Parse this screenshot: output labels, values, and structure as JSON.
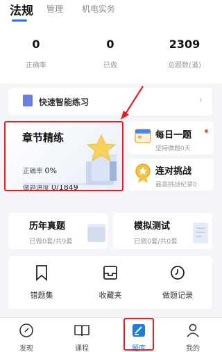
{
  "tabs": [
    {
      "label": "法规",
      "active": true
    },
    {
      "label": "管理",
      "active": false
    },
    {
      "label": "机电实务",
      "active": false
    }
  ],
  "stats": [
    {
      "value": "0",
      "label": "正确率"
    },
    {
      "value": "0",
      "label": "已做"
    },
    {
      "value": "2309",
      "label": "总题数(道)"
    }
  ],
  "quick_practice": {
    "label": "快速智能练习",
    "icon": "book-icon"
  },
  "chapter": {
    "title": "章节精练",
    "accuracy_label": "正确率",
    "accuracy_value": "0%",
    "progress_label": "做题进度",
    "progress_value": "0/1849",
    "progress_fraction": 0.0
  },
  "daily": {
    "title": "每日一题",
    "sub": "坚持做题0天",
    "icon": "calendar-icon"
  },
  "streak": {
    "title": "连对挑战",
    "sub": "最高挑战纪录0",
    "icon": "medal-icon"
  },
  "past_exams": {
    "title": "历年真题",
    "sub": "已做0套/共9套"
  },
  "mock": {
    "title": "模拟测试",
    "sub": "已做0套/共0套"
  },
  "tools": [
    {
      "label": "错题集",
      "icon": "bookmark-icon"
    },
    {
      "label": "收藏夹",
      "icon": "inbox-icon"
    },
    {
      "label": "做题记录",
      "icon": "clock-icon"
    }
  ],
  "nav": [
    {
      "label": "发现",
      "icon": "compass-icon",
      "active": false
    },
    {
      "label": "课程",
      "icon": "open-book-icon",
      "active": false
    },
    {
      "label": "题库",
      "icon": "question-bank-icon",
      "active": true
    },
    {
      "label": "我的",
      "icon": "user-icon",
      "active": false
    }
  ],
  "colors": {
    "accent": "#1e7be0",
    "highlight_box": "#e02020",
    "badge_dot": "#f05a4a"
  }
}
